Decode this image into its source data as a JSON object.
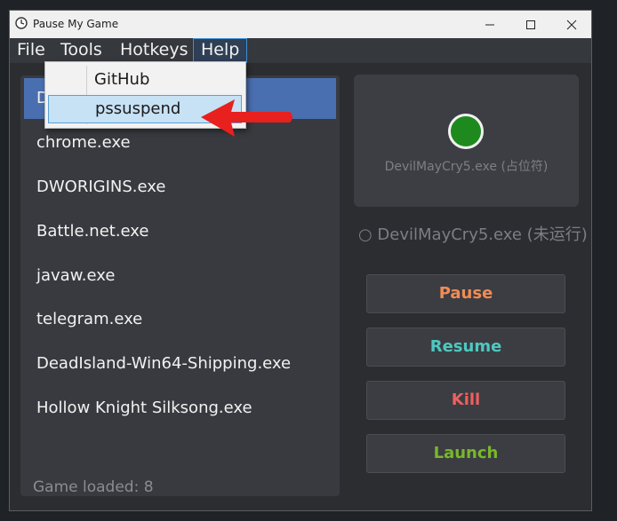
{
  "window": {
    "title": "Pause My Game"
  },
  "menubar": {
    "items": [
      "File",
      "Tools",
      "Hotkeys",
      "Help"
    ]
  },
  "help_menu": {
    "items": [
      "GitHub",
      "pssuspend"
    ]
  },
  "game_list": {
    "items": [
      "DevilMayCry5.exe",
      "chrome.exe",
      "DWORIGINS.exe",
      "Battle.net.exe",
      "javaw.exe",
      "telegram.exe",
      "DeadIsland-Win64-Shipping.exe",
      "Hollow Knight Silksong.exe"
    ],
    "first_item_visible": "D",
    "footer": "Game loaded: 8"
  },
  "preview": {
    "caption": "DevilMayCry5.exe (占位符)"
  },
  "status": {
    "text": "○ DevilMayCry5.exe (未运行)"
  },
  "actions": {
    "pause": "Pause",
    "resume": "Resume",
    "kill": "Kill",
    "launch": "Launch"
  },
  "colors": {
    "pause": "#f08c55",
    "resume": "#4ec8c0",
    "kill": "#ef5f5f",
    "launch": "#78b82a",
    "selection": "#4a6fb0",
    "status_dot": "#1e8a1e",
    "arrow": "#e8201e"
  },
  "icons": [
    "app-clock-icon",
    "minimize-icon",
    "maximize-icon",
    "close-icon",
    "red-arrow-icon"
  ]
}
